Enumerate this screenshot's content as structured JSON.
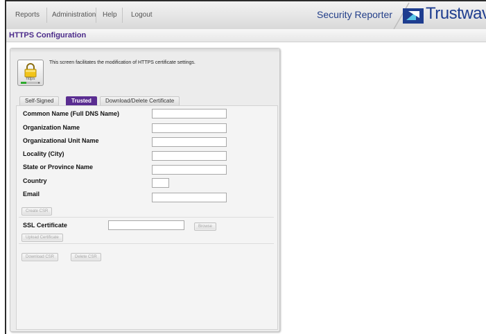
{
  "nav": {
    "reports": "Reports",
    "administration": "Administration",
    "help": "Help",
    "logout": "Logout"
  },
  "brand": {
    "app_name": "Security Reporter",
    "logo_text": "Trustwave",
    "logo_reg": "®"
  },
  "page_title": "HTTPS Configuration",
  "description": "This screen facilitates the modification of HTTPS certificate settings.",
  "icon_caption": "https",
  "tabs": {
    "self_signed": "Self-Signed",
    "trusted": "Trusted",
    "download_delete": "Download/Delete Certificate"
  },
  "form": {
    "common_name": "Common Name (Full DNS Name)",
    "organization": "Organization Name",
    "org_unit": "Organizational Unit Name",
    "locality": "Locality (City)",
    "state": "State or Province Name",
    "country": "Country",
    "email": "Email",
    "create_csr": "Create CSR",
    "ssl_certificate": "SSL Certificate",
    "browse": "Browse",
    "upload_certificate": "Upload Certificate",
    "download_csr": "Download CSR",
    "delete_csr": "Delete CSR"
  },
  "colors": {
    "accent": "#5a2d91",
    "brand_blue": "#1e3d8f"
  }
}
